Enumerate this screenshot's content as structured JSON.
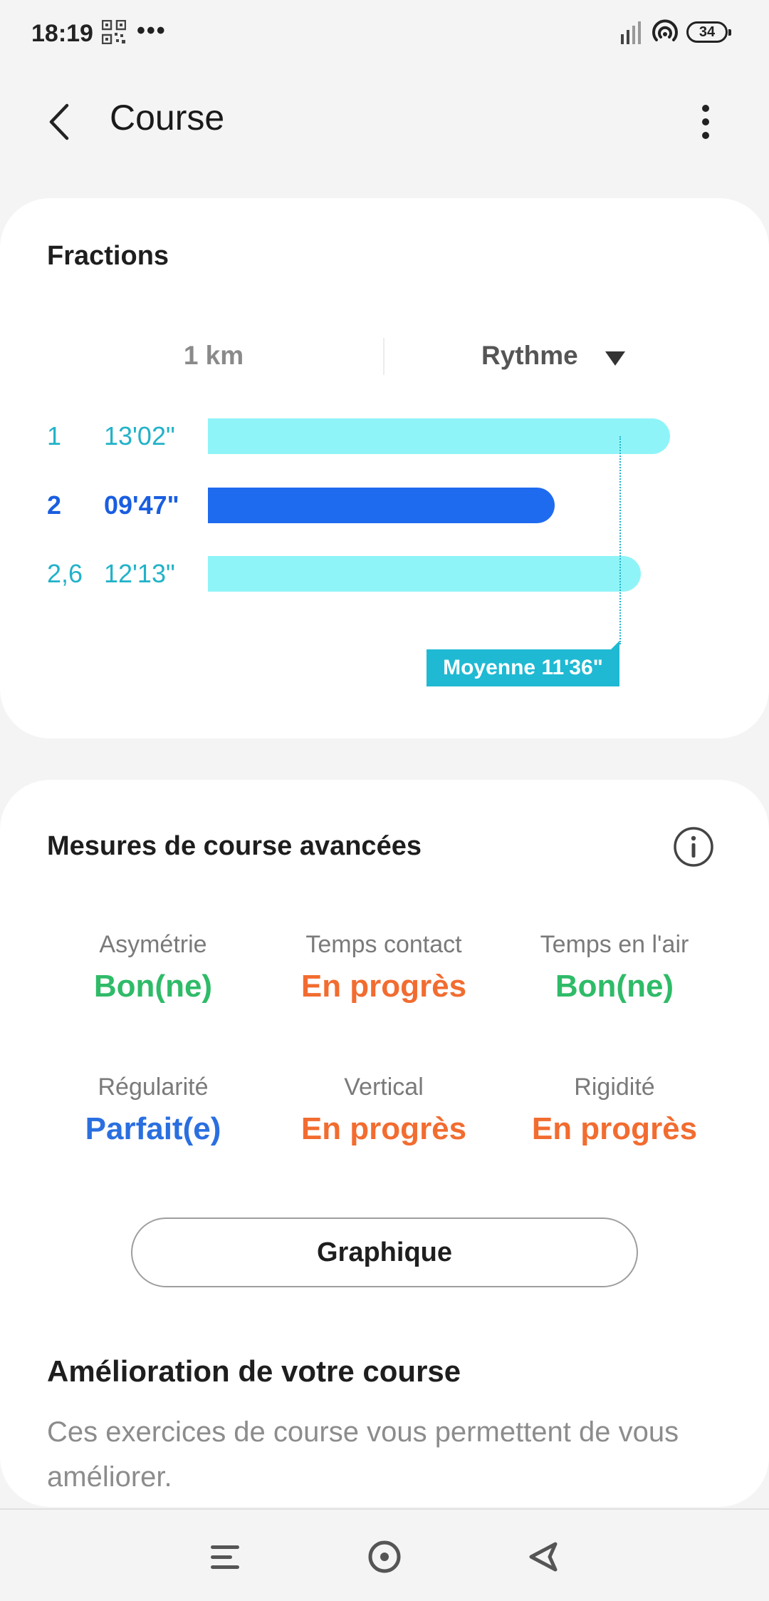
{
  "status": {
    "time": "18:19",
    "battery": "34",
    "icons": [
      "qr-code-icon",
      "more-dots-icon",
      "signal-icon",
      "hotspot-icon",
      "battery-icon"
    ]
  },
  "header": {
    "title": "Course",
    "icons": [
      "back-arrow-icon",
      "more-vertical-icon"
    ]
  },
  "fractions": {
    "title": "Fractions",
    "distance_label": "1 km",
    "metric_label": "Rythme",
    "splits": [
      {
        "num": "1",
        "time": "13'02\"",
        "pace_seconds": 782,
        "active": false
      },
      {
        "num": "2",
        "time": "09'47\"",
        "pace_seconds": 587,
        "active": true
      },
      {
        "num": "2,6",
        "time": "12'13\"",
        "pace_seconds": 733,
        "active": false
      }
    ],
    "average_label": "Moyenne 11'36\"",
    "average_seconds": 696,
    "colors": {
      "bar": "#8ff4f8",
      "bar_active": "#1f6bf0",
      "average": "#1fb9d3"
    }
  },
  "measures": {
    "title": "Mesures de course avancées",
    "items": [
      {
        "label": "Asymétrie",
        "value": "Bon(ne)",
        "color": "#2fbb68"
      },
      {
        "label": "Temps contact",
        "value": "En progrès",
        "color": "#f26c30"
      },
      {
        "label": "Temps en l'air",
        "value": "Bon(ne)",
        "color": "#2fbb68"
      },
      {
        "label": "Régularité",
        "value": "Parfait(e)",
        "color": "#2a6fe0"
      },
      {
        "label": "Vertical",
        "value": "En progrès",
        "color": "#f26c30"
      },
      {
        "label": "Rigidité",
        "value": "En progrès",
        "color": "#f26c30"
      }
    ],
    "graph_button": "Graphique"
  },
  "improve": {
    "title": "Amélioration de votre course",
    "text": "Ces exercices de course vous permettent de vous améliorer."
  },
  "navbar": {
    "icons": [
      "recent-apps-icon",
      "home-icon",
      "back-icon"
    ]
  }
}
